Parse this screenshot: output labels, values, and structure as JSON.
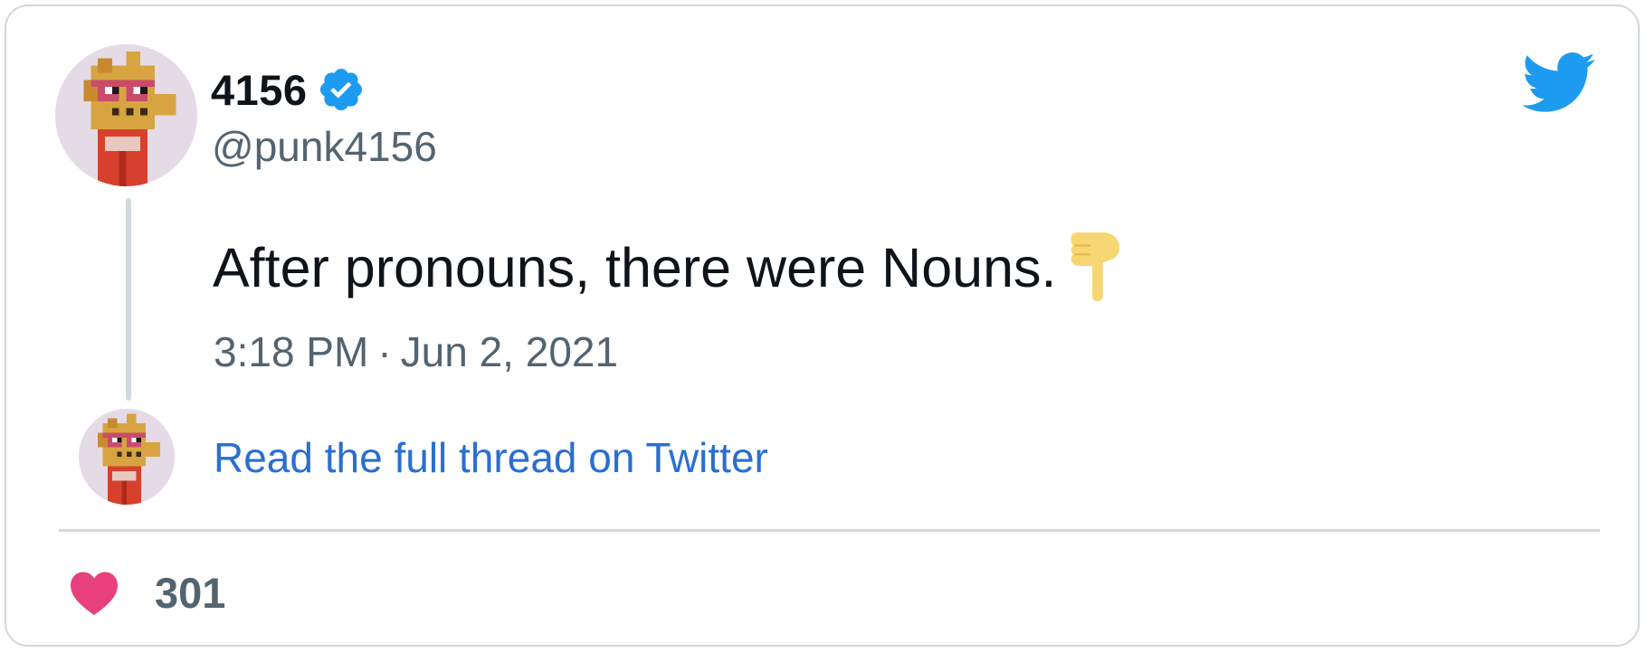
{
  "tweet": {
    "author": {
      "display_name": "4156",
      "handle": "@punk4156",
      "verified": true,
      "avatar_icon": "pixel-punk-avatar"
    },
    "text": "After pronouns, there were Nouns.",
    "emoji": "backhand-index-pointing-down",
    "time": "3:18 PM",
    "separator": "·",
    "date": "Jun 2, 2021",
    "read_thread_label": "Read the full thread on Twitter",
    "likes": "301"
  },
  "icons": {
    "brand": "twitter-bird-icon",
    "verified": "verified-badge-icon",
    "like": "heart-icon"
  },
  "colors": {
    "twitter_blue": "#1d9bf0",
    "link_blue": "#2a6fd0",
    "heart_pink": "#e8407d",
    "text_primary": "#0f1419",
    "text_secondary": "#536471",
    "border": "#cfd9de"
  }
}
